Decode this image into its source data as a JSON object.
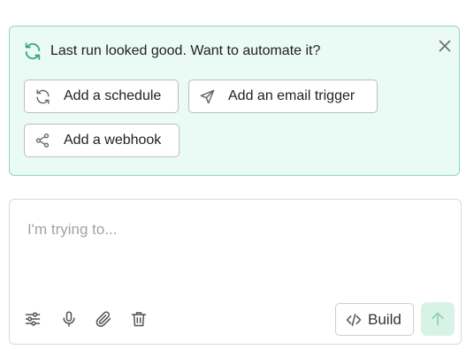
{
  "banner": {
    "title": "Last run looked good. Want to automate it?",
    "icon": "refresh-icon",
    "accent_color": "#3aa57a",
    "background_color": "#eafaf4",
    "border_color": "#8fd9bd",
    "actions": [
      {
        "label": "Add a schedule",
        "icon": "refresh-icon"
      },
      {
        "label": "Add an email trigger",
        "icon": "send-icon"
      },
      {
        "label": "Add a webhook",
        "icon": "share-icon"
      }
    ]
  },
  "composer": {
    "placeholder": "I'm trying to...",
    "value": "",
    "tools": [
      {
        "icon": "sliders-icon"
      },
      {
        "icon": "microphone-icon"
      },
      {
        "icon": "paperclip-icon"
      },
      {
        "icon": "trash-icon"
      }
    ],
    "build_label": "Build",
    "build_icon": "code-icon",
    "send_icon": "arrow-up-icon",
    "send_color": "#d6f3e6"
  }
}
